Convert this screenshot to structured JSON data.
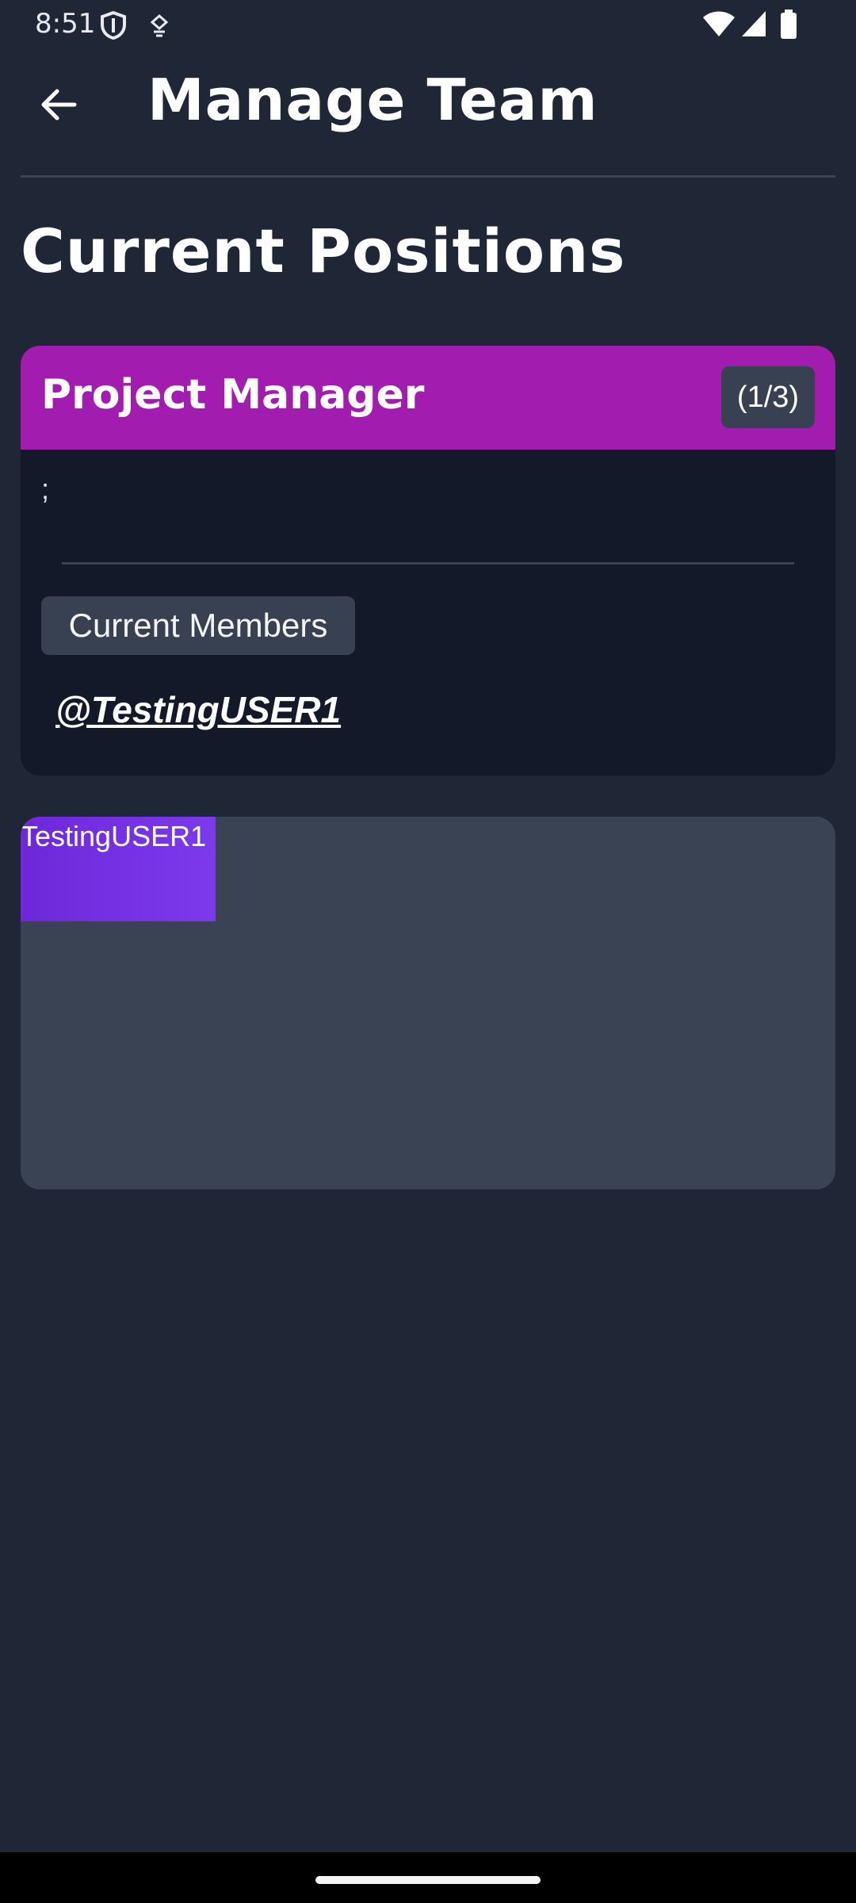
{
  "status_bar": {
    "time": "8:51",
    "icons": [
      "shield-icon",
      "vpn-key-icon",
      "wifi-icon",
      "signal-icon",
      "battery-icon"
    ]
  },
  "app_bar": {
    "title": "Manage Team",
    "back_icon": "arrow-left-icon"
  },
  "section": {
    "title": "Current Positions"
  },
  "position_card": {
    "title": "Project Manager",
    "count": "(1/3)",
    "description": ";",
    "members_label": "Current Members",
    "members": [
      "@TestingUSER1"
    ],
    "header_color": "#a21caf"
  },
  "member_area": {
    "chip_label": "TestingUSER1",
    "chip_color": "#7c3aed"
  },
  "colors": {
    "background": "#1f2736",
    "card_body": "#131929",
    "member_area": "#3a4354"
  }
}
